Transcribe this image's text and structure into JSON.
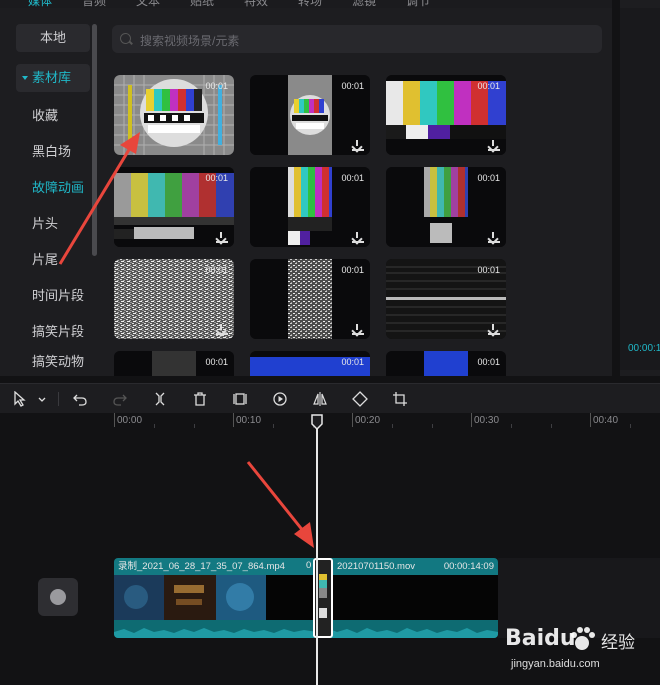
{
  "top_tabs": [
    "媒体",
    "音频",
    "文本",
    "贴纸",
    "特效",
    "转场",
    "滤镜",
    "调节"
  ],
  "sidebar": {
    "items": [
      {
        "label": "本地"
      },
      {
        "label": "素材库"
      },
      {
        "label": "收藏"
      },
      {
        "label": "黑白场"
      },
      {
        "label": "故障动画"
      },
      {
        "label": "片头"
      },
      {
        "label": "片尾"
      },
      {
        "label": "时间片段"
      },
      {
        "label": "搞笑片段"
      },
      {
        "label": "搞笑动物"
      }
    ]
  },
  "search": {
    "placeholder": "搜索视频场景/元素"
  },
  "cards": [
    {
      "duration": "00:01"
    },
    {
      "duration": "00:01"
    },
    {
      "duration": "00:01"
    },
    {
      "duration": "00:01"
    },
    {
      "duration": "00:01"
    },
    {
      "duration": "00:01"
    },
    {
      "duration": "00:01"
    },
    {
      "duration": "00:01"
    },
    {
      "duration": "00:01"
    },
    {
      "duration": "00:01"
    },
    {
      "duration": "00:01"
    },
    {
      "duration": "00:01"
    }
  ],
  "right_panel": {
    "time": "00:00:1"
  },
  "ruler": {
    "ticks": [
      "00:00",
      "00:10",
      "00:20",
      "00:30",
      "00:40"
    ]
  },
  "timeline": {
    "clip1": {
      "name": "录制_2021_06_28_17_35_07_864.mp4"
    },
    "clip2": {
      "name": "20210701150.mov",
      "prefix": "0",
      "duration": "00:00:14:09"
    }
  },
  "watermark": {
    "brand": "Baidu",
    "brand_cn": "经验",
    "url": "jingyan.baidu.com"
  },
  "colors": {
    "accent": "#20b8c8",
    "annotation": "#e8463c"
  }
}
